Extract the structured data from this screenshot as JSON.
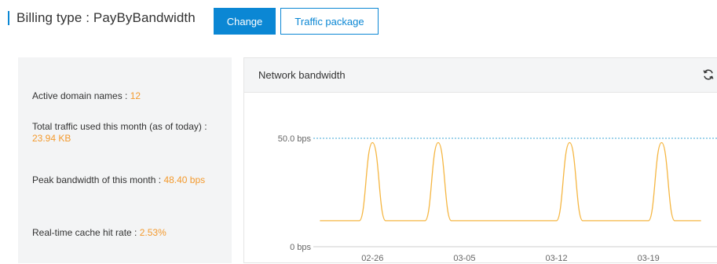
{
  "header": {
    "billing_label": "Billing type : PayByBandwidth",
    "change_label": "Change",
    "traffic_package_label": "Traffic package",
    "accent_color": "#0b87d4"
  },
  "stats": {
    "active_domains_label": "Active domain names  : ",
    "active_domains_value": "12",
    "traffic_label": "Total traffic used this month (as of today)  : ",
    "traffic_value": "23.94 KB",
    "peak_label": "Peak bandwidth of this month  : ",
    "peak_value": "48.40 bps",
    "cache_label": "Real-time cache hit rate  : ",
    "cache_value": "2.53%",
    "value_color": "#f39a2e"
  },
  "chart": {
    "title": "Network bandwidth",
    "refresh_icon": "refresh-icon"
  },
  "chart_data": {
    "type": "line",
    "title": "Network bandwidth",
    "xlabel": "",
    "ylabel": "",
    "x_tick_labels": [
      "02-26",
      "03-05",
      "03-12",
      "03-19"
    ],
    "y_tick_labels": [
      "0 bps",
      "50.0 bps"
    ],
    "ylim": [
      0,
      50
    ],
    "reference_line": {
      "value": 50,
      "label": "50.0 bps",
      "style": "dashed",
      "color": "#3ea7d6"
    },
    "grid": false,
    "series": [
      {
        "color": "#f5b642",
        "x": [
          "02-22",
          "02-23",
          "02-24",
          "02-25",
          "02-26",
          "02-27",
          "02-28",
          "03-01",
          "03-02",
          "03-03",
          "03-04",
          "03-05",
          "03-06",
          "03-07",
          "03-08",
          "03-09",
          "03-10",
          "03-11",
          "03-12",
          "03-13",
          "03-14",
          "03-15",
          "03-16",
          "03-17",
          "03-18",
          "03-19",
          "03-20",
          "03-21",
          "03-22",
          "03-23"
        ],
        "values": [
          12,
          12,
          12,
          12,
          48,
          12,
          12,
          12,
          12,
          48,
          12,
          12,
          12,
          12,
          12,
          12,
          12,
          12,
          12,
          48,
          12,
          12,
          12,
          12,
          12,
          12,
          48,
          12,
          12,
          12
        ]
      }
    ]
  }
}
